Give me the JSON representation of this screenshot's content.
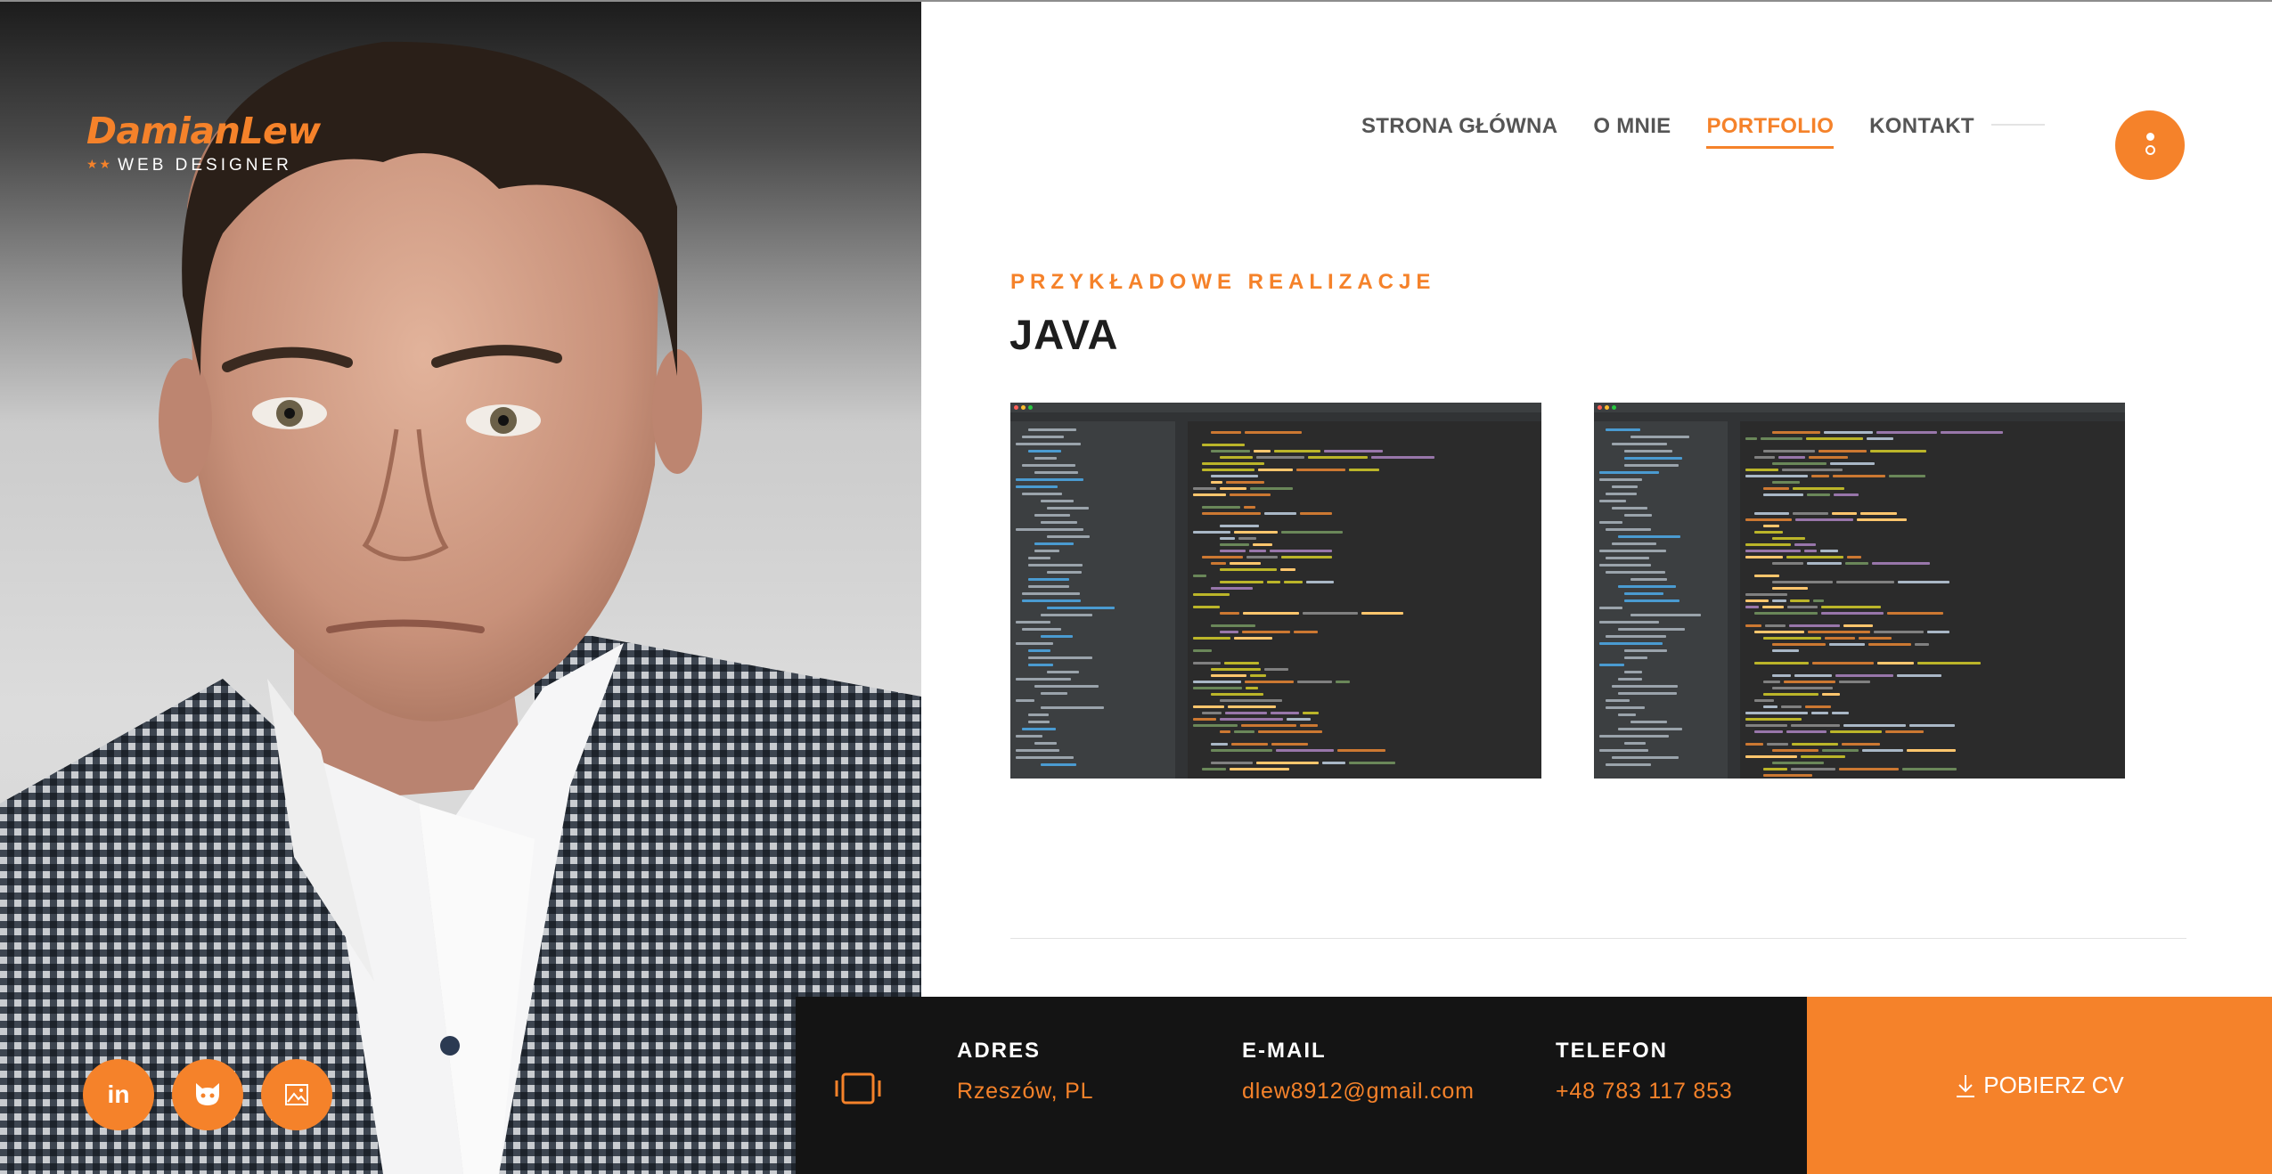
{
  "colors": {
    "accent": "#f5822a",
    "footer": "#141414",
    "text": "#1d1d1d",
    "nav": "#555555"
  },
  "logo": {
    "name": "DamianLew",
    "stars": "★★",
    "subtitle": "WEB DESIGNER"
  },
  "photo": {
    "icon": "portrait-photo"
  },
  "social": [
    {
      "name": "linkedin",
      "label": "in",
      "icon": "linkedin-icon"
    },
    {
      "name": "github",
      "icon": "github-icon"
    },
    {
      "name": "gallery",
      "icon": "image-icon"
    }
  ],
  "nav": {
    "items": [
      {
        "label": "STRONA GŁÓWNA"
      },
      {
        "label": "O MNIE"
      },
      {
        "label": "PORTFOLIO",
        "active": true
      },
      {
        "label": "KONTAKT"
      }
    ],
    "menu_icon": "dots-menu-icon"
  },
  "main": {
    "kicker": "PRZYKŁADOWE REALIZACJE",
    "heading": "JAVA",
    "screenshots": [
      {
        "name": "intellij-screenshot-1",
        "theme": "dark"
      },
      {
        "name": "intellij-screenshot-2",
        "theme": "dark"
      }
    ]
  },
  "footer": {
    "icon": "tablet-icon",
    "address": {
      "label": "ADRES",
      "value": "Rzeszów, PL"
    },
    "email": {
      "label": "E-MAIL",
      "value": "dlew8912@gmail.com"
    },
    "phone": {
      "label": "TELEFON",
      "value": "+48 783 117 853"
    },
    "cv_button": "POBIERZ CV",
    "cv_icon": "download-icon"
  }
}
